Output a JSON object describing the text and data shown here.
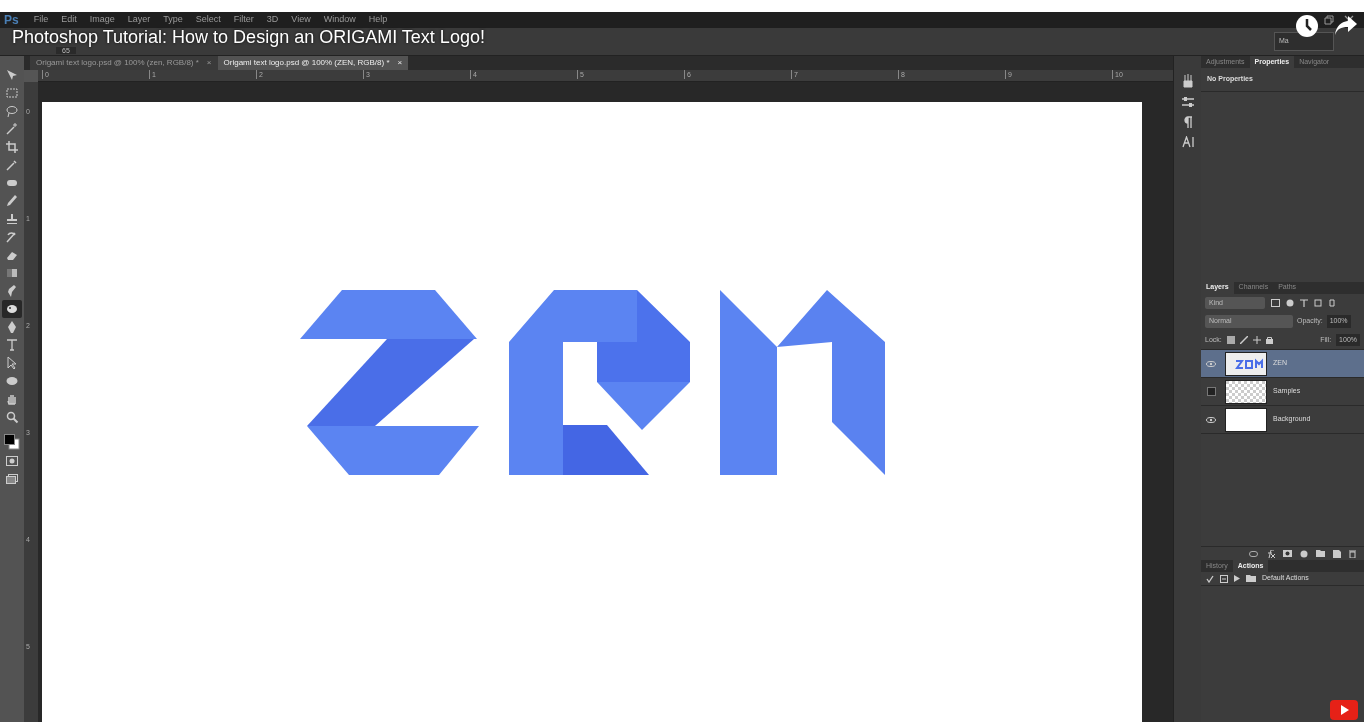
{
  "video_title": "Photoshop Tutorial: How to Design an ORIGAMI Text Logo!",
  "app": {
    "logo": "Ps",
    "menu": [
      "File",
      "Edit",
      "Image",
      "Layer",
      "Type",
      "Select",
      "Filter",
      "3D",
      "View",
      "Window",
      "Help"
    ]
  },
  "options_bar": {
    "size": "65",
    "workspace": "Ma"
  },
  "document_tabs": [
    {
      "label": "Origami text logo.psd @ 100% (zen, RGB/8) *",
      "close": "×",
      "selected": false
    },
    {
      "label": "Origami text logo.psd @ 100% (ZEN, RGB/8) *",
      "close": "×",
      "selected": true
    }
  ],
  "rulers": {
    "horizontal": [
      "0",
      "1",
      "2",
      "3",
      "4",
      "5",
      "6",
      "7",
      "8",
      "9",
      "10"
    ],
    "vertical": [
      "0",
      "1",
      "2",
      "3",
      "4",
      "5"
    ]
  },
  "tools": [
    {
      "selected": false
    },
    {
      "selected": false
    },
    {
      "selected": false
    },
    {
      "selected": false
    },
    {
      "selected": false
    },
    {
      "selected": false
    },
    {
      "selected": false
    },
    {
      "selected": false
    },
    {
      "selected": false
    },
    {
      "selected": false
    },
    {
      "selected": false
    },
    {
      "selected": false
    },
    {
      "selected": false
    },
    {
      "selected": true
    },
    {
      "selected": false
    },
    {
      "selected": false
    },
    {
      "selected": false
    },
    {
      "selected": false
    },
    {
      "selected": false
    },
    {
      "selected": false
    }
  ],
  "properties_panel": {
    "tabs": [
      {
        "label": "Adjustments",
        "selected": false
      },
      {
        "label": "Properties",
        "selected": true
      },
      {
        "label": "Navigator",
        "selected": false
      }
    ],
    "message": "No Properties"
  },
  "layers_panel": {
    "tabs": [
      {
        "label": "Layers",
        "selected": true
      },
      {
        "label": "Channels",
        "selected": false
      },
      {
        "label": "Paths",
        "selected": false
      }
    ],
    "filter": "Kind",
    "blend_mode": "Normal",
    "opacity_label": "Opacity:",
    "opacity": "100%",
    "lock_label": "Lock:",
    "fill_label": "Fill:",
    "fill": "100%",
    "layers": [
      {
        "name": "ZEN",
        "visible": true,
        "selected": true,
        "kind": "text"
      },
      {
        "name": "Samples",
        "visible": false,
        "selected": false,
        "kind": "transparent"
      },
      {
        "name": "Background",
        "visible": true,
        "selected": false,
        "kind": "white"
      }
    ]
  },
  "actions_panel": {
    "tabs": [
      {
        "label": "History",
        "selected": false
      },
      {
        "label": "Actions",
        "selected": true
      }
    ],
    "items": [
      {
        "name": "Default Actions",
        "checked": true
      }
    ]
  }
}
